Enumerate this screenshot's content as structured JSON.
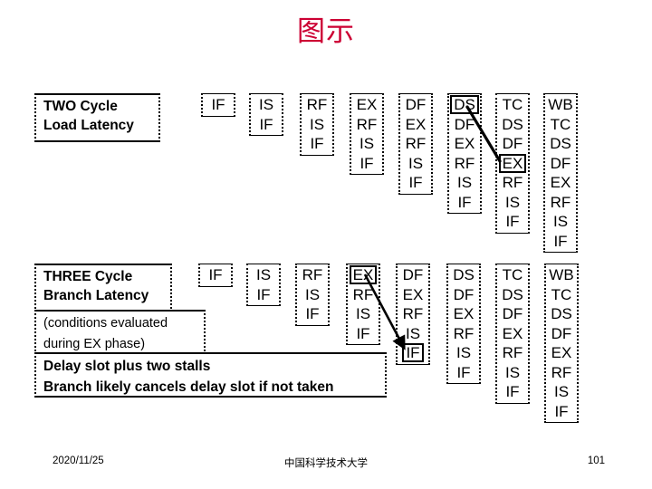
{
  "slide": {
    "title": "图示",
    "title_color": "#CC0033"
  },
  "callouts": {
    "two_cycle": {
      "line1": "TWO Cycle",
      "line2": "Load Latency"
    },
    "three_cycle": {
      "line1": "THREE Cycle",
      "line2": "Branch Latency"
    },
    "conditions": {
      "line1": "(conditions evaluated",
      "line2": " during EX phase)"
    },
    "delay_slot": {
      "line1": "Delay slot plus two stalls",
      "line2": "Branch likely cancels delay slot if not taken"
    }
  },
  "pipelines": [
    {
      "name": "two-cycle-load-latency",
      "columns": [
        {
          "stages": [
            "IF"
          ],
          "highlight": null
        },
        {
          "stages": [
            "IS",
            "IF"
          ],
          "highlight": null
        },
        {
          "stages": [
            "RF",
            "IS",
            "IF"
          ],
          "highlight": null
        },
        {
          "stages": [
            "EX",
            "RF",
            "IS",
            "IF"
          ],
          "highlight": null
        },
        {
          "stages": [
            "DF",
            "EX",
            "RF",
            "IS",
            "IF"
          ],
          "highlight": null
        },
        {
          "stages": [
            "DS",
            "DF",
            "EX",
            "RF",
            "IS",
            "IF"
          ],
          "highlight": 0
        },
        {
          "stages": [
            "TC",
            "DS",
            "DF",
            "EX",
            "RF",
            "IS",
            "IF"
          ],
          "highlight": 3
        },
        {
          "stages": [
            "WB",
            "TC",
            "DS",
            "DF",
            "EX",
            "RF",
            "IS",
            "IF"
          ],
          "highlight": null
        }
      ]
    },
    {
      "name": "three-cycle-branch-latency",
      "columns": [
        {
          "stages": [
            "IF"
          ],
          "highlight": null
        },
        {
          "stages": [
            "IS",
            "IF"
          ],
          "highlight": null
        },
        {
          "stages": [
            "RF",
            "IS",
            "IF"
          ],
          "highlight": null
        },
        {
          "stages": [
            "EX",
            "RF",
            "IS",
            "IF"
          ],
          "highlight": 0
        },
        {
          "stages": [
            "DF",
            "EX",
            "RF",
            "IS",
            "IF"
          ],
          "highlight": 4
        },
        {
          "stages": [
            "DS",
            "DF",
            "EX",
            "RF",
            "IS",
            "IF"
          ],
          "highlight": null
        },
        {
          "stages": [
            "TC",
            "DS",
            "DF",
            "EX",
            "RF",
            "IS",
            "IF"
          ],
          "highlight": null
        },
        {
          "stages": [
            "WB",
            "TC",
            "DS",
            "DF",
            "EX",
            "RF",
            "IS",
            "IF"
          ],
          "highlight": null
        }
      ]
    }
  ],
  "footer": {
    "date": "2020/11/25",
    "organization": "中国科学技术大学",
    "page_number": "101"
  }
}
